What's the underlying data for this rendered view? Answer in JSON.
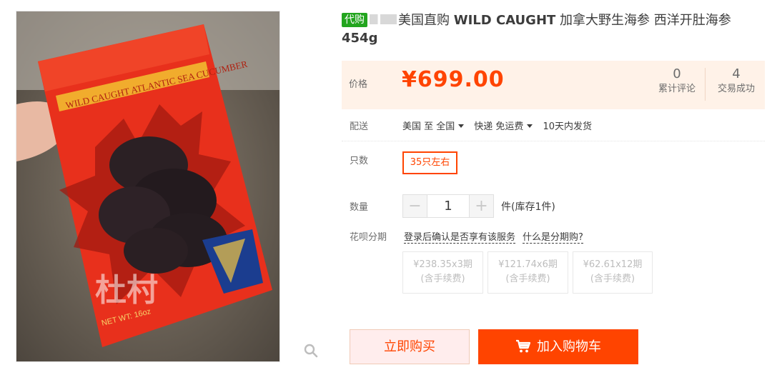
{
  "product": {
    "tag": "代购",
    "title_part1": "美国直购 ",
    "title_bold1": "WILD CAUGHT",
    "title_part2": " 加拿大野生海参 西洋开肚海参",
    "title_bold2": "454g"
  },
  "image": {
    "bag_banner_text": "WILD CAUGHT ATLANTIC SEA CUCUMBER",
    "net_wt": "NET WT: 16oz",
    "watermark": "杜村"
  },
  "price": {
    "label": "价格",
    "value": "¥699.00",
    "reviews_count": "0",
    "reviews_label": "累计评论",
    "trades_count": "4",
    "trades_label": "交易成功"
  },
  "delivery": {
    "label": "配送",
    "from": "美国 至",
    "to": "全国",
    "shipping": "快递 免运费",
    "ship_time": "10天内发货"
  },
  "sku": {
    "label": "只数",
    "option": "35只左右"
  },
  "quantity": {
    "label": "数量",
    "minus": "−",
    "value": "1",
    "plus": "+",
    "stock": "件(库存1件)"
  },
  "huabei": {
    "label": "花呗分期",
    "login_text": "登录后确认是否享有该服务",
    "help_text": "什么是分期购?",
    "plans": [
      {
        "amount": "¥238.35x3期",
        "fee": "(含手续费)"
      },
      {
        "amount": "¥121.74x6期",
        "fee": "(含手续费)"
      },
      {
        "amount": "¥62.61x12期",
        "fee": "(含手续费)"
      }
    ]
  },
  "actions": {
    "buy_now": "立即购买",
    "add_cart": "加入购物车"
  },
  "colors": {
    "accent": "#ff4400",
    "tag_green": "#23a51f",
    "price_bg": "#fff2e8"
  }
}
